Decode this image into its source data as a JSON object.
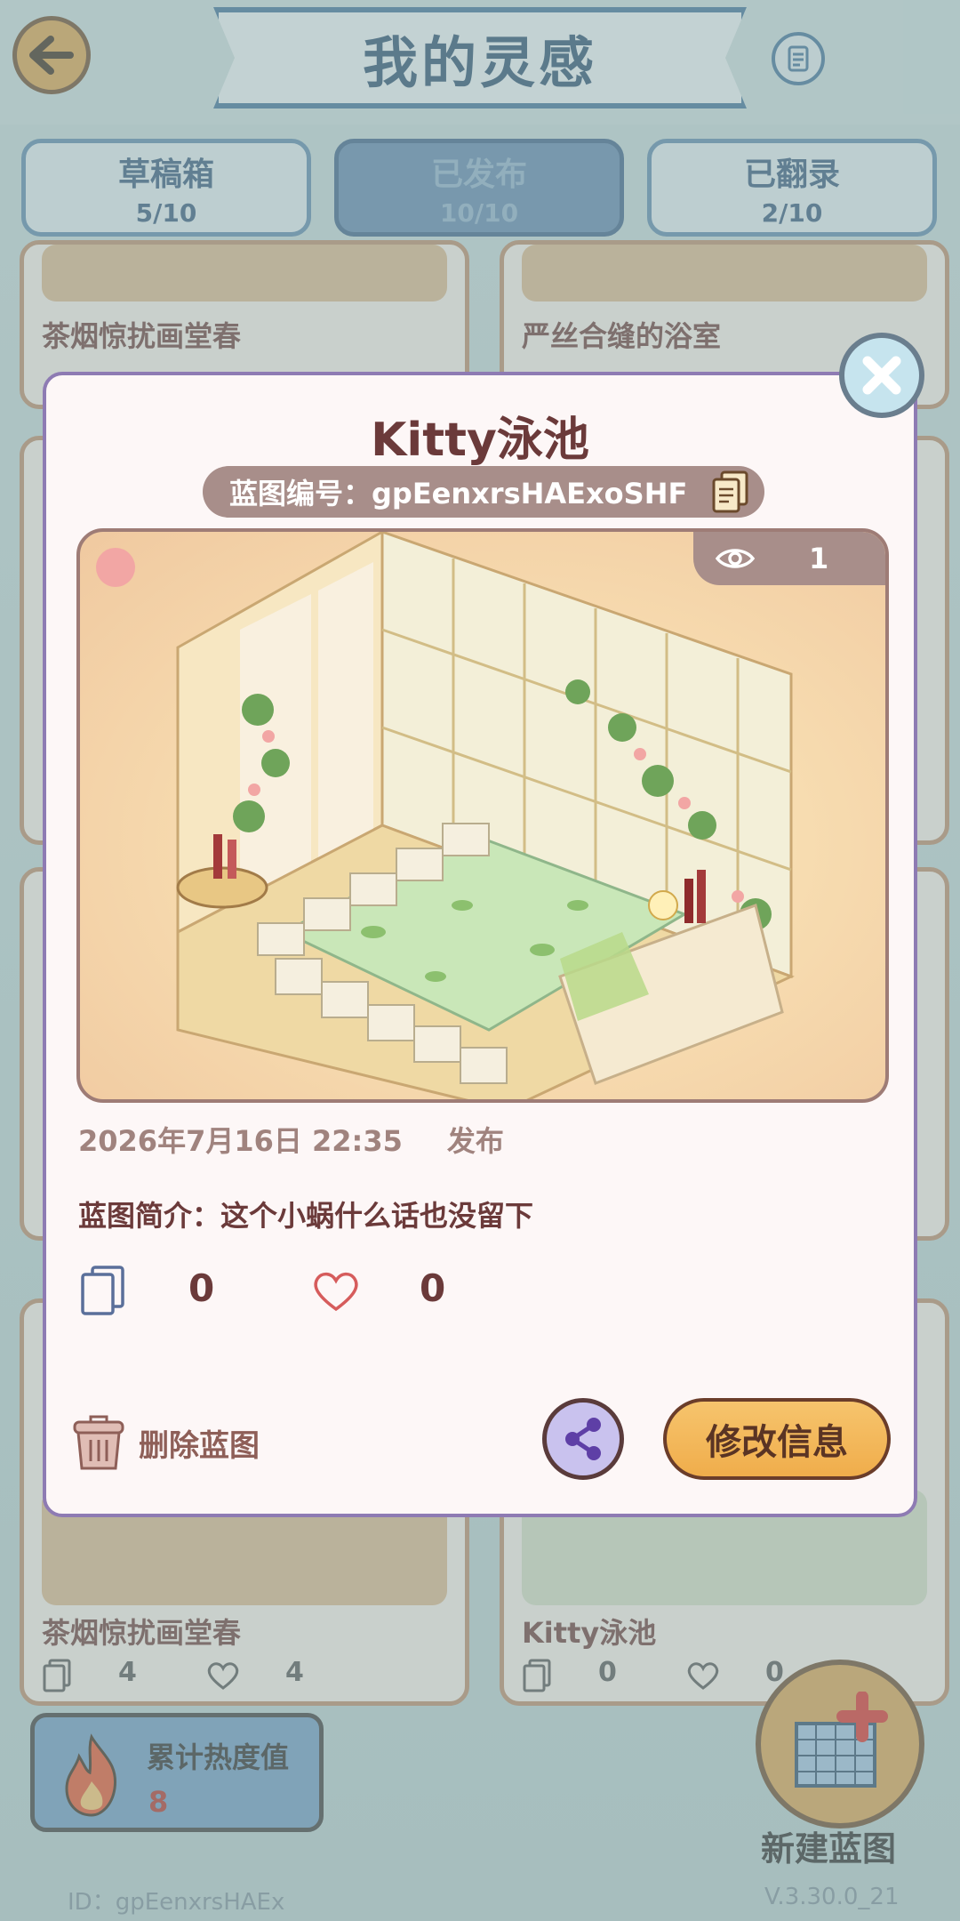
{
  "header": {
    "title": "我的灵感"
  },
  "tabs": [
    {
      "label": "草稿箱",
      "count": "5/10",
      "active": false
    },
    {
      "label": "已发布",
      "count": "10/10",
      "active": true
    },
    {
      "label": "已翻录",
      "count": "2/10",
      "active": false
    }
  ],
  "background_cards": [
    {
      "name": "茶烟惊扰画堂春"
    },
    {
      "name": "严丝合缝的浴室"
    },
    {
      "name": "茶烟惊扰画堂春",
      "copies": "4",
      "likes": "4"
    },
    {
      "name": "Kitty泳池",
      "copies": "0",
      "likes": "0"
    }
  ],
  "heat": {
    "label": "累计热度值",
    "value": "8"
  },
  "new_blueprint": {
    "label": "新建蓝图"
  },
  "footer": {
    "id": "ID：gpEenxrsHAEx",
    "version": "V.3.30.0_21"
  },
  "dialog": {
    "title": "Kitty泳池",
    "code": "蓝图编号：gpEenxrsHAExoSHF",
    "views": "1",
    "publish_time": "2026年7月16日 22:35",
    "publish_status": "发布",
    "description": "蓝图简介：这个小蜗什么话也没留下",
    "copies": "0",
    "likes": "0",
    "delete_label": "删除蓝图",
    "edit_label": "修改信息"
  },
  "colors": {
    "dialog_title": "#6b3a3a",
    "accent_orange": "#f0ad4b",
    "tab_active": "#5f86ab",
    "heat_value": "#b0342a"
  },
  "icons": [
    "back-arrow-icon",
    "scroll-icon",
    "copy-icon",
    "heart-icon",
    "eye-icon",
    "trash-icon",
    "share-icon",
    "close-icon",
    "fire-icon",
    "blueprint-plus-icon"
  ]
}
